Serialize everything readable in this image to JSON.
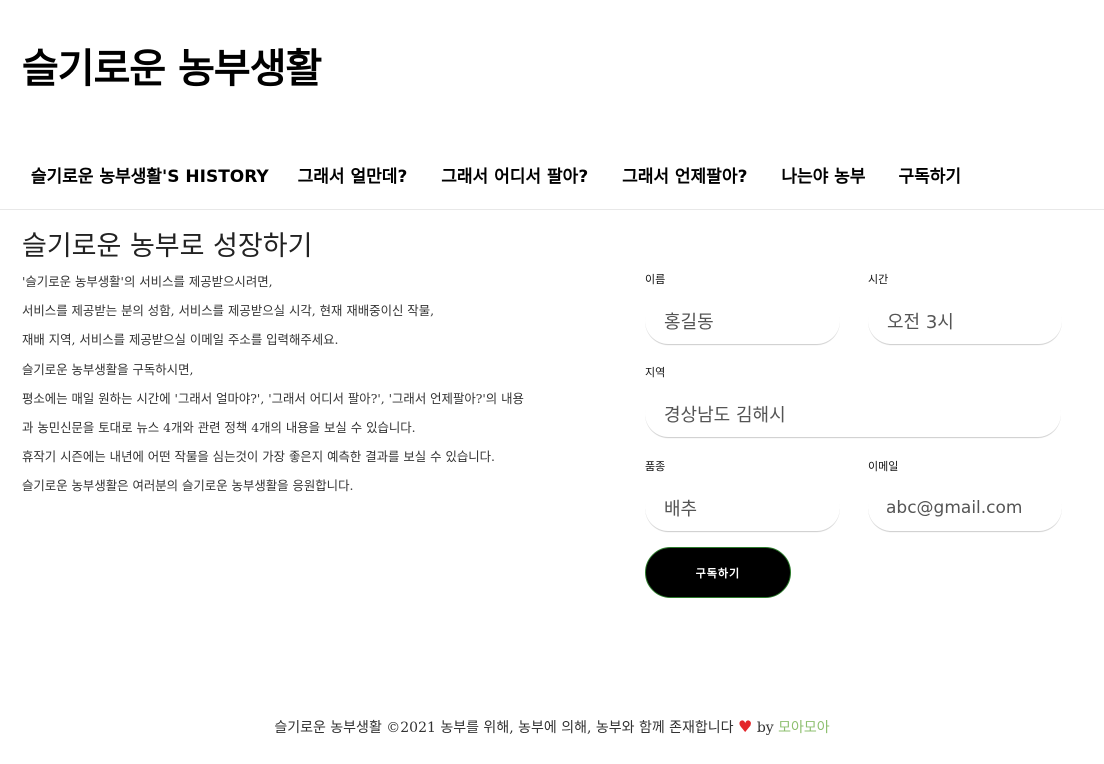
{
  "site": {
    "title": "슬기로운 농부생활"
  },
  "nav": {
    "items": [
      {
        "label": "슬기로운 농부생활'S HISTORY"
      },
      {
        "label": "그래서 얼만데?"
      },
      {
        "label": "그래서 어디서 팔아?"
      },
      {
        "label": "그래서 언제팔아?"
      },
      {
        "label": "나는야 농부"
      },
      {
        "label": "구독하기"
      }
    ]
  },
  "main": {
    "title": "슬기로운 농부로 성장하기",
    "paragraphs": [
      "'슬기로운 농부생활'의 서비스를 제공받으시려면,",
      "서비스를 제공받는 분의 성함, 서비스를 제공받으실 시각, 현재 재배중이신 작물,",
      "재배 지역, 서비스를 제공받으실 이메일 주소를 입력해주세요.",
      "슬기로운 농부생활을 구독하시면,",
      "평소에는 매일 원하는 시간에 '그래서 얼마야?', '그래서 어디서 팔아?', '그래서 언제팔아?'의 내용",
      "과 농민신문을 토대로 뉴스 4개와 관련 정책 4개의 내용을 보실 수 있습니다.",
      "휴작기 시즌에는 내년에 어떤 작물을 심는것이 가장 좋은지 예측한 결과를 보실 수 있습니다.",
      "슬기로운 농부생활은 여러분의 슬기로운 농부생활을 응원합니다."
    ]
  },
  "form": {
    "name": {
      "label": "이름",
      "value": "홍길동"
    },
    "time": {
      "label": "시간",
      "value": "오전 3시"
    },
    "region": {
      "label": "지역",
      "value": "경상남도 김해시"
    },
    "crop": {
      "label": "품종",
      "value": "배추"
    },
    "email": {
      "label": "이메일",
      "value": "abc@gmail.com"
    },
    "submit_label": "구독하기"
  },
  "footer": {
    "text": "슬기로운 농부생활 ©2021 농부를 위해, 농부에 의해, 농부와 함께 존재합니다",
    "heart": "♥",
    "by": "by",
    "author": "모아모아"
  }
}
